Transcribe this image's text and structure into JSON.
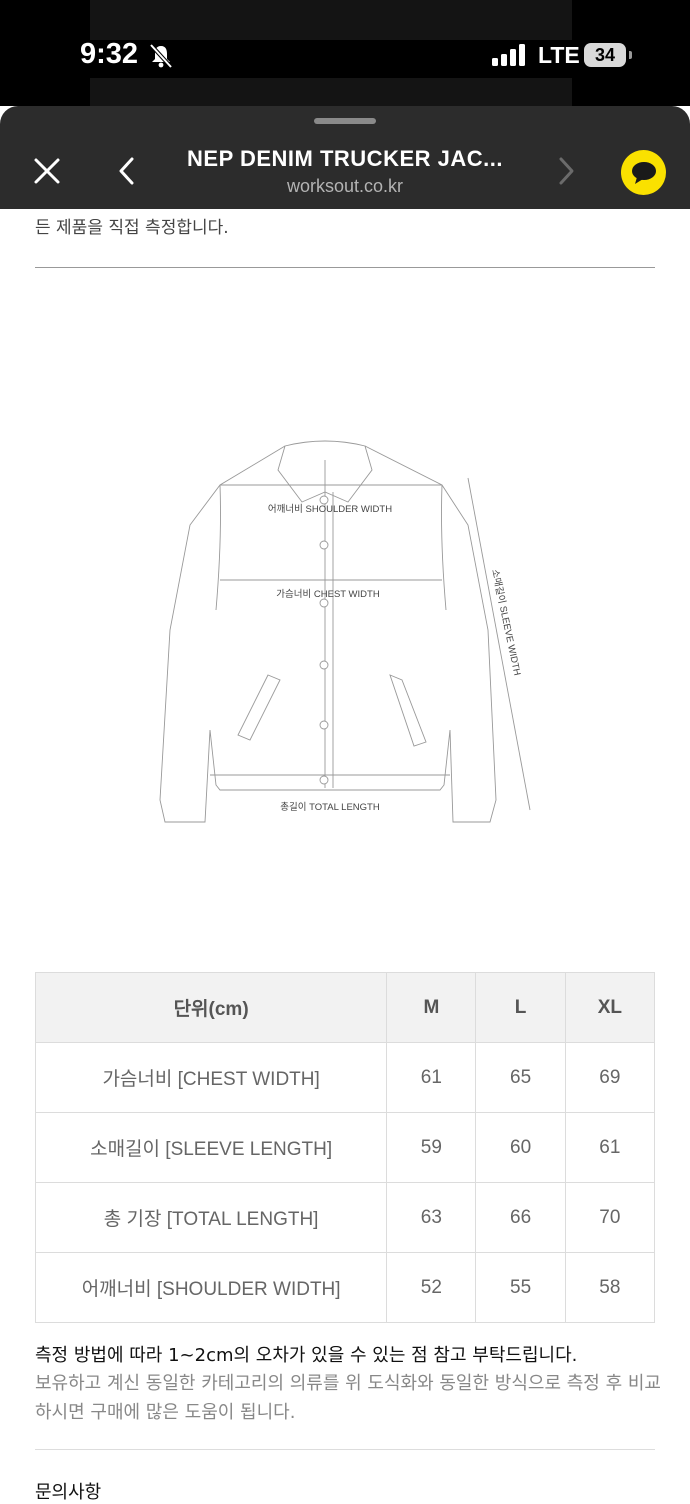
{
  "status_bar": {
    "time": "9:32",
    "network": "LTE",
    "battery": "34"
  },
  "header": {
    "title": "NEP DENIM TRUCKER JAC...",
    "domain": "worksout.co.kr"
  },
  "content": {
    "intro": "든 제품을 직접 측정합니다.",
    "diagram_labels": {
      "shoulder": "어깨너비 SHOULDER WIDTH",
      "chest": "가슴너비 CHEST WIDTH",
      "sleeve": "소매길이 SLEEVE WIDTH",
      "total": "총길이 TOTAL LENGTH"
    },
    "size_table": {
      "headers": [
        "단위(cm)",
        "M",
        "L",
        "XL"
      ],
      "rows": [
        [
          "가슴너비 [CHEST WIDTH]",
          "61",
          "65",
          "69"
        ],
        [
          "소매길이 [SLEEVE LENGTH]",
          "59",
          "60",
          "61"
        ],
        [
          "총 기장 [TOTAL LENGTH]",
          "63",
          "66",
          "70"
        ],
        [
          "어깨너비 [SHOULDER WIDTH]",
          "52",
          "55",
          "58"
        ]
      ]
    },
    "note_primary": "측정 방법에 따라 1~2cm의 오차가 있을 수 있는 점 참고 부탁드립니다.",
    "note_secondary": "보유하고 계신 동일한 카테고리의 의류를 위 도식화와 동일한 방식으로 측정 후 비교하시면 구매에 많은 도움이 됩니다.",
    "inquiry_heading": "문의사항"
  },
  "colors": {
    "sheet_header": "#2c2c2c",
    "kakao_yellow": "#fae100",
    "table_header_bg": "#f2f2f2"
  },
  "icons": [
    "bell-slash-icon",
    "signal-icon",
    "close-icon",
    "back-icon",
    "forward-icon",
    "chat-bubble-icon"
  ]
}
